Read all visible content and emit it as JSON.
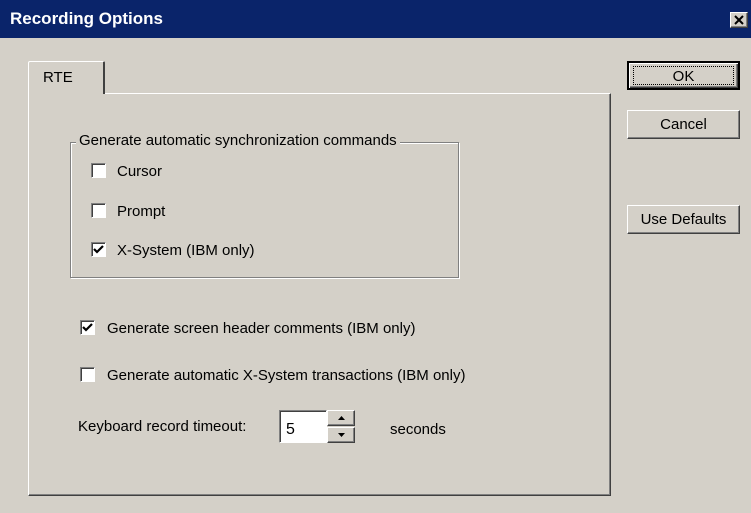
{
  "window": {
    "title": "Recording Options",
    "close_glyph": "✕",
    "title_bar_color": "#0a246a",
    "face_color": "#d4d0c8"
  },
  "tabs": [
    {
      "label": "RTE",
      "selected": true
    }
  ],
  "sync_group": {
    "legend": "Generate automatic synchronization commands",
    "items": [
      {
        "label": "Cursor",
        "checked": false
      },
      {
        "label": "Prompt",
        "checked": false
      },
      {
        "label": "X-System (IBM only)",
        "checked": true
      }
    ]
  },
  "options": [
    {
      "label": "Generate screen header comments (IBM only)",
      "checked": true
    },
    {
      "label": "Generate automatic X-System transactions (IBM only)",
      "checked": false
    }
  ],
  "timeout": {
    "label": "Keyboard record timeout:",
    "value": "5",
    "units": "seconds"
  },
  "buttons": {
    "ok": "OK",
    "cancel": "Cancel",
    "use_defaults": "Use Defaults"
  },
  "icons": {
    "close": "close-icon",
    "check": "checkmark-icon",
    "spin_up": "arrow-up-icon",
    "spin_down": "arrow-down-icon"
  }
}
